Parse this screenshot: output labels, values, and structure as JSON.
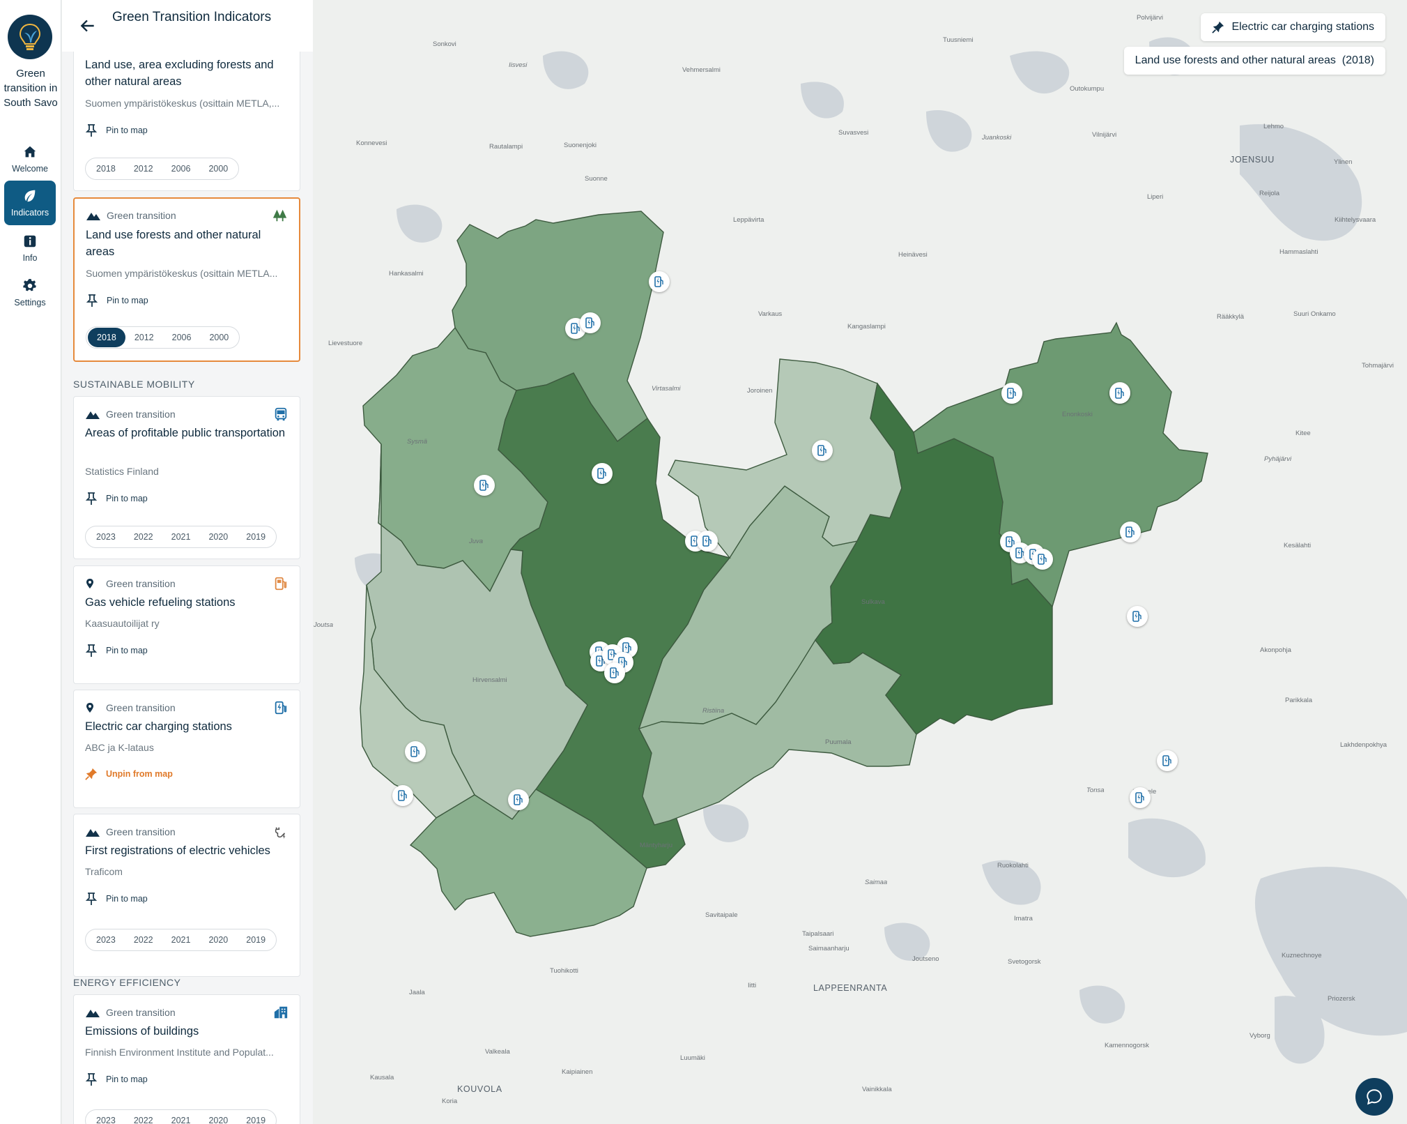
{
  "app": {
    "brand_name": "Green transition in South Savo",
    "nav": [
      {
        "label": "Welcome",
        "icon": "home-icon"
      },
      {
        "label": "Indicators",
        "icon": "leaf-icon",
        "active": true
      },
      {
        "label": "Info",
        "icon": "info-icon"
      },
      {
        "label": "Settings",
        "icon": "gear-icon"
      }
    ]
  },
  "panel": {
    "title": "Green Transition Indicators",
    "sections": [
      {
        "label": "SUSTAINABLE MOBILITY"
      },
      {
        "label": "ENERGY EFFICIENCY"
      }
    ],
    "cards": [
      {
        "title": "Land use, area excluding forests and other natural areas",
        "source": "Suomen ympäristökeskus (osittain METLA,...",
        "pin_label": "Pin to map",
        "years": [
          "2018",
          "2012",
          "2006",
          "2000"
        ]
      },
      {
        "category": "Green transition",
        "category_icon": "mountain-icon",
        "type_icon": "trees-icon",
        "title": "Land use forests and other natural areas",
        "source": "Suomen ympäristökeskus (osittain METLA...",
        "pin_label": "Pin to map",
        "years": [
          "2018",
          "2012",
          "2006",
          "2000"
        ],
        "active_year": "2018",
        "selected": true
      },
      {
        "category": "Green transition",
        "category_icon": "mountain-icon",
        "type_icon": "bus-icon",
        "title": "Areas of profitable public transportation",
        "source": "Statistics Finland",
        "pin_label": "Pin to map",
        "years": [
          "2023",
          "2022",
          "2021",
          "2020",
          "2019"
        ]
      },
      {
        "category": "Green transition",
        "category_icon": "location-pin-icon",
        "type_icon": "gas-pump-icon",
        "title": "Gas vehicle refueling stations",
        "source": "Kaasuautoilijat ry",
        "pin_label": "Pin to map"
      },
      {
        "category": "Green transition",
        "category_icon": "location-pin-icon",
        "type_icon": "ev-charger-icon",
        "title": "Electric car charging stations",
        "source": "ABC ja K-lataus",
        "pin_label": "Unpin from map",
        "pinned": true
      },
      {
        "category": "Green transition",
        "category_icon": "mountain-icon",
        "type_icon": "ev-plug-icon",
        "title": "First registrations of electric vehicles",
        "source": "Traficom",
        "pin_label": "Pin to map",
        "years": [
          "2023",
          "2022",
          "2021",
          "2020",
          "2019"
        ]
      },
      {
        "category": "Green transition",
        "category_icon": "mountain-icon",
        "type_icon": "building-icon",
        "title": "Emissions of buildings",
        "source": "Finnish Environment Institute and Populat...",
        "pin_label": "Pin to map",
        "years": [
          "2023",
          "2022",
          "2021",
          "2020",
          "2019"
        ]
      }
    ]
  },
  "map": {
    "active_layers": [
      {
        "label": "Electric car charging stations",
        "icon": "pinned-icon"
      },
      {
        "label": "Land use forests and other natural areas  (2018)"
      }
    ],
    "place_labels": [
      "Polvijärvi",
      "Sonkovi",
      "Tuusniemi",
      "Iisvesi",
      "Vehmersalmi",
      "Outokumpu",
      "Juankoski",
      "Konnevesi",
      "Rautalampi",
      "Suonenjoki",
      "Suvasvesi",
      "Vilnijärvi",
      "Lehmo",
      "JOENSUU",
      "Ylinen",
      "Suonne",
      "Liperi",
      "Reijola",
      "Leppävirta",
      "Kiihtelysvaara",
      "Hankasalmi",
      "Heinävesi",
      "Hammaslahti",
      "Varkaus",
      "Kangaslampi",
      "Rääkkylä",
      "Suuri Onkamo",
      "Lievestuore",
      "Tohmajärvi",
      "Joroinen",
      "Enonkoski",
      "Virtasalmi",
      "Kitee",
      "Sysmä",
      "Pyhäjärvi",
      "Kesälahti",
      "Sulkava",
      "Juva",
      "Joutsa",
      "Akonpohja",
      "Hirvensalmi",
      "Parikkala",
      "Lakhdenpokhya",
      "Puumala",
      "Ristiina",
      "Tonsa",
      "Simpele",
      "Mäntyharju",
      "Ruokolahti",
      "Saimaa",
      "Imatra",
      "Savitaipale",
      "Taipalsaari",
      "Saimaanharju",
      "Kuznechnoye",
      "Joutseno",
      "Svetogorsk",
      "Tuohikotti",
      "Jaala",
      "LAPPEENRANTA",
      "Iitti",
      "Priozersk",
      "Kamennogorsk",
      "Valkeala",
      "Luumäki",
      "Kausala",
      "Kaipiainen",
      "KOUVOLA",
      "Vainikkala",
      "Koria",
      "Vyborg"
    ]
  }
}
